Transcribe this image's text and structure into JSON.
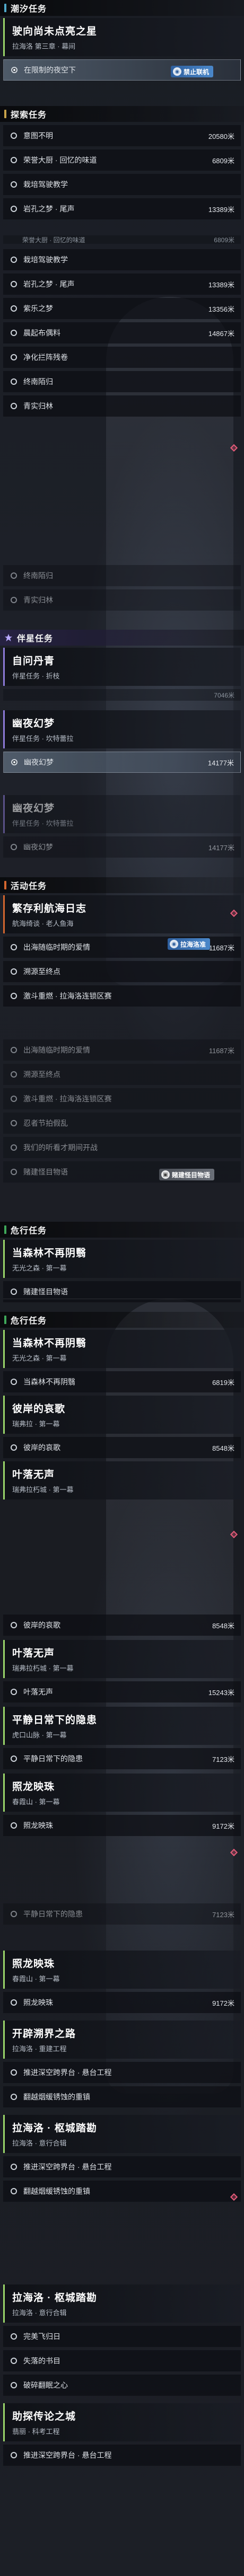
{
  "sections": {
    "s1": {
      "header": "潮汐任务",
      "accent": "#4fa8c9"
    },
    "s2": {
      "header": "探索任务",
      "accent": "#c7a24a"
    },
    "s3": {
      "header": "伴星任务",
      "accent": "#7a6fc9"
    },
    "s4": {
      "header": "活动任务",
      "accent": "#d3662f"
    },
    "s5": {
      "header": "危行任务",
      "accent": "#3fa85a"
    },
    "s6": {
      "header": "危行任务",
      "accent": "#3fa85a"
    }
  },
  "quests": {
    "q1": {
      "title": "驶向尚未点亮之星",
      "sub": "拉海洛 第三章 · 幕间"
    },
    "q2": {
      "title": "自问丹青",
      "sub": "伴星任务 · 折枝"
    },
    "q3": {
      "title": "幽夜幻梦",
      "sub": "伴星任务 · 坎特蕾拉"
    },
    "q4": {
      "title": "幽夜幻梦",
      "sub": "伴星任务 · 坎特蕾拉"
    },
    "q5": {
      "title": "繁存利航海日志",
      "sub": "航海绮谈 · 老人鱼海"
    },
    "q6": {
      "title": "当森林不再阴翳",
      "sub": "无光之森 · 第一幕"
    },
    "q7": {
      "title": "当森林不再阴翳",
      "sub": "无光之森 · 第一幕"
    },
    "q8": {
      "title": "彼岸的哀歌",
      "sub": "瑞弗拉 · 第一幕"
    },
    "q9": {
      "title": "叶落无声",
      "sub": "瑞弗拉朽城 · 第一幕"
    },
    "q10": {
      "title": "叶落无声",
      "sub": "瑞弗拉朽城 · 第一幕"
    },
    "q11": {
      "title": "平静日常下的隐患",
      "sub": "虎口山脉 · 第一幕"
    },
    "q12": {
      "title": "照龙映珠",
      "sub": "春霞山 · 第一幕"
    },
    "q13": {
      "title": "照龙映珠",
      "sub": "春霞山 · 第一幕"
    },
    "q14": {
      "title": "开辟溯界之路",
      "sub": "拉海洛 · 重建工程"
    },
    "q15": {
      "title": "拉海洛 · 枢城踏勘",
      "sub": "拉海洛 · 意行合辑"
    },
    "q16": {
      "title": "拉海洛 · 枢城踏勘",
      "sub": "拉海洛 · 意行合辑"
    },
    "q17": {
      "title": "助探传论之城",
      "sub": "翡丽 · 科考工程"
    }
  },
  "rows": {
    "r1": {
      "label": "在限制的夜空下",
      "dist": ""
    },
    "r2": {
      "label": "意图不明",
      "dist": "20580米"
    },
    "r3": {
      "label": "荣誉大厨 · 回忆的味道",
      "dist": "6809米"
    },
    "r4": {
      "label": "栽培驾驶教学",
      "dist": ""
    },
    "r5": {
      "label": "岩孔之梦 · 尾声",
      "dist": "13389米"
    },
    "r6": {
      "label": "荣誉大厨 · 回忆的味道",
      "dist": "6809米"
    },
    "r7": {
      "label": "栽培驾驶教学",
      "dist": ""
    },
    "r8": {
      "label": "岩孔之梦 · 尾声",
      "dist": "13389米"
    },
    "r9": {
      "label": "紫乐之梦",
      "dist": "13356米"
    },
    "r10": {
      "label": "晨起布偶料",
      "dist": "14867米"
    },
    "r11": {
      "label": "净化拦阵残卷",
      "dist": ""
    },
    "r12": {
      "label": "终南陌归",
      "dist": ""
    },
    "r13": {
      "label": "青实归林",
      "dist": ""
    },
    "r14": {
      "label": "终南陌归",
      "dist": ""
    },
    "r15": {
      "label": "青实归林",
      "dist": ""
    },
    "r16": {
      "label": "",
      "dist": "7046米"
    },
    "r17": {
      "label": "幽夜幻梦",
      "dist": "14177米"
    },
    "r18": {
      "label": "幽夜幻梦",
      "dist": "14177米"
    },
    "r19": {
      "label": "出海随临时期的爱情",
      "dist": "11687米"
    },
    "r20": {
      "label": "溯源至终点",
      "dist": ""
    },
    "r21": {
      "label": "激斗重燃 · 拉海洛连锁区赛",
      "dist": ""
    },
    "r22": {
      "label": "出海随临时期的爱情",
      "dist": "11687米"
    },
    "r23": {
      "label": "溯源至终点",
      "dist": ""
    },
    "r24": {
      "label": "激斗重燃 · 拉海洛连锁区赛",
      "dist": ""
    },
    "r25": {
      "label": "忍者节拍假乱",
      "dist": ""
    },
    "r26": {
      "label": "我们的听看才期间开战",
      "dist": ""
    },
    "r27": {
      "label": "赌建怪目物语",
      "dist": ""
    },
    "r28": {
      "label": "赌建怪目物语",
      "dist": ""
    },
    "r29": {
      "label": "当森林不再阴翳",
      "dist": "6819米"
    },
    "r30": {
      "label": "彼岸的哀歌",
      "dist": "8548米"
    },
    "r31": {
      "label": "彼岸的哀歌",
      "dist": "8548米"
    },
    "r32": {
      "label": "叶落无声",
      "dist": "15243米"
    },
    "r33": {
      "label": "平静日常下的隐患",
      "dist": "7123米"
    },
    "r34": {
      "label": "平静日常下的隐患",
      "dist": "7123米"
    },
    "r35": {
      "label": "照龙映珠",
      "dist": "9172米"
    },
    "r36": {
      "label": "照龙映珠",
      "dist": "9172米"
    },
    "r37": {
      "label": "推进深空跨界台 · 悬台工程",
      "dist": ""
    },
    "r38": {
      "label": "翻越烟缓锈蚀的重镇",
      "dist": ""
    },
    "r39": {
      "label": "推进深空跨界台 · 悬台工程",
      "dist": ""
    },
    "r40": {
      "label": "翻越烟缓锈蚀的重镇",
      "dist": ""
    },
    "r41": {
      "label": "完美飞归日",
      "dist": ""
    },
    "r42": {
      "label": "失落的书目",
      "dist": ""
    },
    "r43": {
      "label": "破碎翻眠之心",
      "dist": ""
    },
    "r44": {
      "label": "推进深空跨界台 · 悬台工程",
      "dist": ""
    }
  },
  "badges": {
    "track1": "禁止联机",
    "track2": "拉海洛准",
    "track3": "赌建怪目物语"
  },
  "colors": {
    "active_border": "#9ad66a",
    "pin_diamond": "#e35a78",
    "badge_blue": "#3c74b5"
  }
}
